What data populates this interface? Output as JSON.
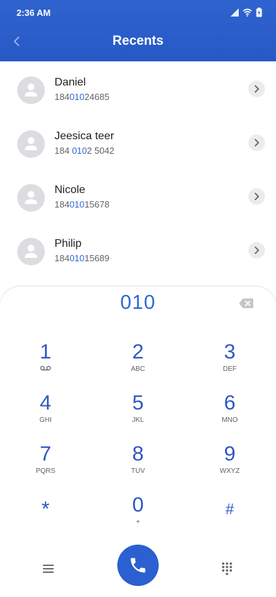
{
  "status_bar": {
    "time": "2:36 AM",
    "icons": [
      "signal-icon",
      "wifi-icon",
      "battery-icon"
    ]
  },
  "header": {
    "title": "Recents",
    "back_icon": "chevron-left-icon"
  },
  "recents": [
    {
      "name": "Daniel",
      "number_pre": "184",
      "number_match": "010",
      "number_post": "24685"
    },
    {
      "name": "Jeesica teer",
      "number_pre": "184 ",
      "number_match": "010",
      "number_post": "2 5042"
    },
    {
      "name": "Nicole",
      "number_pre": "184",
      "number_match": "010",
      "number_post": "15678"
    },
    {
      "name": "Philip",
      "number_pre": "184",
      "number_match": "010",
      "number_post": "15689"
    }
  ],
  "dialer": {
    "input": "010",
    "keys": [
      {
        "digit": "1",
        "letters": ""
      },
      {
        "digit": "2",
        "letters": "ABC"
      },
      {
        "digit": "3",
        "letters": "DEF"
      },
      {
        "digit": "4",
        "letters": "GHI"
      },
      {
        "digit": "5",
        "letters": "JKL"
      },
      {
        "digit": "6",
        "letters": "MNO"
      },
      {
        "digit": "7",
        "letters": "PQRS"
      },
      {
        "digit": "8",
        "letters": "TUV"
      },
      {
        "digit": "9",
        "letters": "WXYZ"
      },
      {
        "digit": "*",
        "letters": ""
      },
      {
        "digit": "0",
        "letters": "+"
      },
      {
        "digit": "#",
        "letters": ""
      }
    ]
  },
  "colors": {
    "accent": "#2c5fd0",
    "header": "#2759c5",
    "match": "#2f67d6"
  }
}
